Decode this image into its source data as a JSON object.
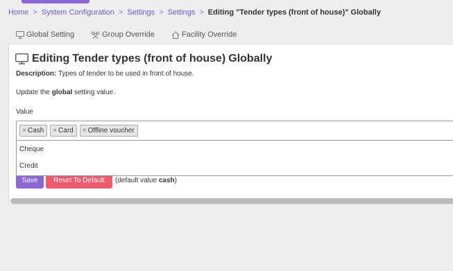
{
  "breadcrumb": {
    "items": [
      "Home",
      "System Configuration",
      "Settings",
      "Settings"
    ],
    "separator": ">",
    "current": "Editing \"Tender types (front of house)\" Globally"
  },
  "tabs": [
    {
      "label": "Global Setting",
      "icon": "monitor-icon"
    },
    {
      "label": "Group Override",
      "icon": "group-icon"
    },
    {
      "label": "Facility Override",
      "icon": "home-icon"
    }
  ],
  "card": {
    "title_prefix": "Editing",
    "title_name": "Tender types (front of house)",
    "title_suffix": "Globally",
    "description_label": "Description:",
    "description_text": "Types of tender to be used in front of house.",
    "instruction_pre": "Update the",
    "instruction_bold": "global",
    "instruction_post": "setting value.",
    "value_label": "Value"
  },
  "select": {
    "tags": [
      "Cash",
      "Card",
      "Offline voucher"
    ],
    "remove_glyph": "×",
    "options": [
      "Cheque",
      "Credit"
    ]
  },
  "actions": {
    "save_label": "Save",
    "reset_label": "Reset To Default",
    "default_note_pre": "(default value",
    "default_note_value": "cash",
    "default_note_post": ")"
  },
  "colors": {
    "accent": "#8b66d6",
    "danger": "#ef5a6a",
    "link": "#6e59c9"
  }
}
